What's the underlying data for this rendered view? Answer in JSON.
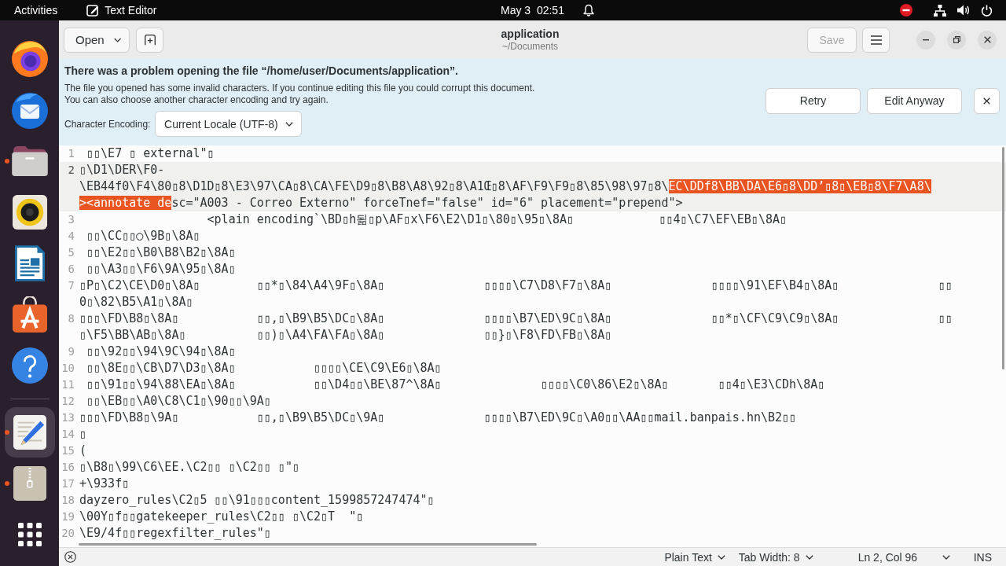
{
  "top_bar": {
    "activities": "Activities",
    "app_name": "Text Editor",
    "clock": "May 3  02:51"
  },
  "dock": {
    "favorites": [
      {
        "kind": "browser",
        "running": false,
        "selected": false
      },
      {
        "kind": "mail",
        "running": false,
        "selected": false
      },
      {
        "kind": "files",
        "running": true,
        "selected": false
      },
      {
        "kind": "music",
        "running": false,
        "selected": false
      },
      {
        "kind": "writer",
        "running": false,
        "selected": false
      },
      {
        "kind": "store",
        "running": false,
        "selected": false
      },
      {
        "kind": "help",
        "running": false,
        "selected": false
      }
    ],
    "open_apps": [
      {
        "kind": "editor",
        "running": true,
        "selected": true
      },
      {
        "kind": "archive",
        "running": true,
        "selected": false
      }
    ]
  },
  "header_bar": {
    "open_label": "Open",
    "title": "application",
    "subtitle": "~/Documents",
    "save_label": "Save",
    "save_disabled": true
  },
  "info_bar": {
    "title": "There was a problem opening the file “/home/user/Documents/application”.",
    "message": [
      "The file you opened has some invalid characters. If you continue editing this file you could corrupt this document.",
      "You can also choose another character encoding and try again."
    ],
    "encoding_label": "Character Encoding:",
    "encoding_value": "Current Locale (UTF-8)",
    "buttons": [
      "Retry",
      "Edit Anyway"
    ]
  },
  "editor": {
    "lines": [
      {
        "number": "1",
        "current": false,
        "rows": [
          [
            {
              "text": " ▯▯\\E7 ▯ external\"▯",
              "selected": false
            }
          ]
        ]
      },
      {
        "number": "2",
        "current": true,
        "rows": [
          [
            {
              "text": "▯\\D1\\DER\\F0-",
              "selected": false
            }
          ],
          [
            {
              "text": "\\EB44f0\\F4\\80▯8\\D1D▯8\\E3\\97\\CA▯8\\CA\\FE\\D9▯8\\B8\\A8\\92▯8\\A1Œ▯8\\AF\\F9\\F9▯8\\85\\98\\97▯8\\",
              "selected": false
            },
            {
              "text": "EC\\DDf8\\BB\\DA\\E6▯8\\DD’▯8▯\\EB▯8\\F7\\A8\\",
              "selected": true
            }
          ],
          [
            {
              "text": "><annotate de",
              "selected": true
            },
            {
              "text": "sc=\"A003 - Correo Externo\" forceTnef=\"false\" id=\"6\" placement=\"prepend\">",
              "selected": false
            }
          ]
        ]
      },
      {
        "number": "3",
        "current": false,
        "rows": [
          [
            {
              "text": "                  <plain encoding`\\BD▯h됢▯p\\AF▯x\\F6\\E2\\D1▯\\80▯\\95▯\\8A▯            ▯▯4▯\\C7\\EF\\EB▯\\8A▯",
              "selected": false
            }
          ]
        ]
      },
      {
        "number": "4",
        "current": false,
        "rows": [
          [
            {
              "text": " ▯▯\\CC▯▯◯\\9B▯\\8A▯",
              "selected": false
            }
          ]
        ]
      },
      {
        "number": "5",
        "current": false,
        "rows": [
          [
            {
              "text": " ▯▯\\E2▯▯\\B0\\B8\\B2▯\\8A▯",
              "selected": false
            }
          ]
        ]
      },
      {
        "number": "6",
        "current": false,
        "rows": [
          [
            {
              "text": " ▯▯\\A3▯▯\\F6\\9A\\95▯\\8A▯",
              "selected": false
            }
          ]
        ]
      },
      {
        "number": "7",
        "current": false,
        "rows": [
          [
            {
              "text": "▯P▯\\C2\\CE\\D0▯\\8A▯        ▯▯*▯\\84\\A4\\9F▯\\8A▯              ▯▯▯▯\\C7\\D8\\F7▯\\8A▯              ▯▯▯▯\\91\\EF\\B4▯\\8A▯              ▯▯",
              "selected": false
            }
          ],
          [
            {
              "text": "0▯\\82\\B5\\A1▯\\8A▯",
              "selected": false
            }
          ]
        ]
      },
      {
        "number": "8",
        "current": false,
        "rows": [
          [
            {
              "text": "▯▯▯\\FD\\B8▯\\8A▯           ▯▯,▯\\B9\\B5\\DC▯\\8A▯              ▯▯▯▯\\B7\\ED\\9C▯\\8A▯              ▯▯*▯\\CF\\C9\\C9▯\\8A▯              ▯▯",
              "selected": false
            }
          ],
          [
            {
              "text": "▯\\F5\\BB\\AB▯\\8A▯          ▯▯)▯\\A4\\FA\\FA▯\\8A▯              ▯▯}▯\\F8\\FD\\FB▯\\8A▯",
              "selected": false
            }
          ]
        ]
      },
      {
        "number": "9",
        "current": false,
        "rows": [
          [
            {
              "text": " ▯▯\\92▯▯\\94\\9C\\94▯\\8A▯",
              "selected": false
            }
          ]
        ]
      },
      {
        "number": "10",
        "current": false,
        "rows": [
          [
            {
              "text": " ▯▯\\8E▯▯\\CB\\D7\\D3▯\\8A▯           ▯▯▯▯\\CE\\C9\\E6▯\\8A▯",
              "selected": false
            }
          ]
        ]
      },
      {
        "number": "11",
        "current": false,
        "rows": [
          [
            {
              "text": " ▯▯\\91▯▯\\94\\88\\EA▯\\8A▯           ▯▯\\D4▯▯\\BE\\87^\\8A▯              ▯▯▯▯\\C0\\86\\E2▯\\8A▯       ▯▯4▯\\E3\\CDh\\8A▯",
              "selected": false
            }
          ]
        ]
      },
      {
        "number": "12",
        "current": false,
        "rows": [
          [
            {
              "text": " ▯▯\\EB▯▯\\A0\\C8\\C1▯\\90▯▯\\9A▯",
              "selected": false
            }
          ]
        ]
      },
      {
        "number": "13",
        "current": false,
        "rows": [
          [
            {
              "text": "▯▯▯\\FD\\B8▯\\9A▯           ▯▯,▯\\B9\\B5\\DC▯\\9A▯              ▯▯▯▯\\B7\\ED\\9C▯\\A0▯▯\\AA▯▯mail.banpais.hn\\B2▯▯",
              "selected": false
            }
          ]
        ]
      },
      {
        "number": "14",
        "current": false,
        "rows": [
          [
            {
              "text": "▯",
              "selected": false
            }
          ]
        ]
      },
      {
        "number": "15",
        "current": false,
        "rows": [
          [
            {
              "text": "(",
              "selected": false
            }
          ]
        ]
      },
      {
        "number": "16",
        "current": false,
        "rows": [
          [
            {
              "text": "▯\\B8▯\\99\\C6\\EE.\\C2▯▯ ▯\\C2▯▯ ▯\"▯",
              "selected": false
            }
          ]
        ]
      },
      {
        "number": "17",
        "current": false,
        "rows": [
          [
            {
              "text": "+\\933f▯",
              "selected": false
            }
          ]
        ]
      },
      {
        "number": "18",
        "current": false,
        "rows": [
          [
            {
              "text": "dayzero_rules\\C2▯5 ▯▯\\91▯▯▯content_1599857247474\"▯",
              "selected": false
            }
          ]
        ]
      },
      {
        "number": "19",
        "current": false,
        "rows": [
          [
            {
              "text": "\\00Y▯f▯▯gatekeeper_rules\\C2▯▯ ▯\\C2▯T  \"▯",
              "selected": false
            }
          ]
        ]
      },
      {
        "number": "20",
        "current": false,
        "rows": [
          [
            {
              "text": "\\E9/4f▯▯regexfilter_rules\"▯",
              "selected": false
            }
          ]
        ]
      }
    ]
  },
  "status_bar": {
    "language": "Plain Text",
    "tab_width": "Tab Width: 8",
    "position": "Ln 2, Col 96",
    "mode": "INS"
  }
}
